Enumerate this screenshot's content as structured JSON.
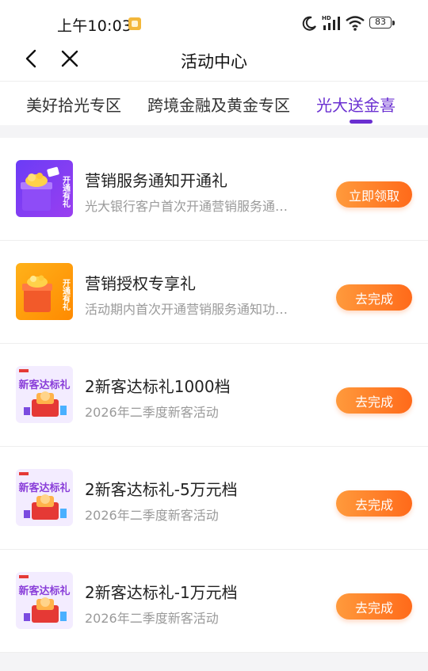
{
  "status_bar": {
    "time": "上午10:03",
    "battery": "83",
    "network_label": "HD"
  },
  "nav": {
    "title": "活动中心",
    "back_icon": "chevron-left-icon",
    "close_icon": "close-icon"
  },
  "tabs": [
    {
      "label": "美好拾光专区",
      "active": false
    },
    {
      "label": "跨境金融及黄金专区",
      "active": false
    },
    {
      "label": "光大送金喜",
      "active": true
    }
  ],
  "thumb_texts": {
    "kaitong_youli": "开通有礼",
    "xinke_dabiao": "新客达标礼"
  },
  "items": [
    {
      "title": "营销服务通知开通礼",
      "subtitle": "光大银行客户首次开通营销服务通…",
      "button": "立即领取",
      "thumb": "purple-gift"
    },
    {
      "title": "营销授权专享礼",
      "subtitle": "活动期内首次开通营销服务通知功…",
      "button": "去完成",
      "thumb": "orange-gift"
    },
    {
      "title": "2新客达标礼1000档",
      "subtitle": "2026年二季度新客活动",
      "button": "去完成",
      "thumb": "new-customer-gift"
    },
    {
      "title": "2新客达标礼-5万元档",
      "subtitle": "2026年二季度新客活动",
      "button": "去完成",
      "thumb": "new-customer-gift"
    },
    {
      "title": "2新客达标礼-1万元档",
      "subtitle": "2026年二季度新客活动",
      "button": "去完成",
      "thumb": "new-customer-gift"
    }
  ],
  "colors": {
    "accent": "#6a2fd1",
    "button_start": "#ff9a3c",
    "button_end": "#ff6a1a"
  }
}
